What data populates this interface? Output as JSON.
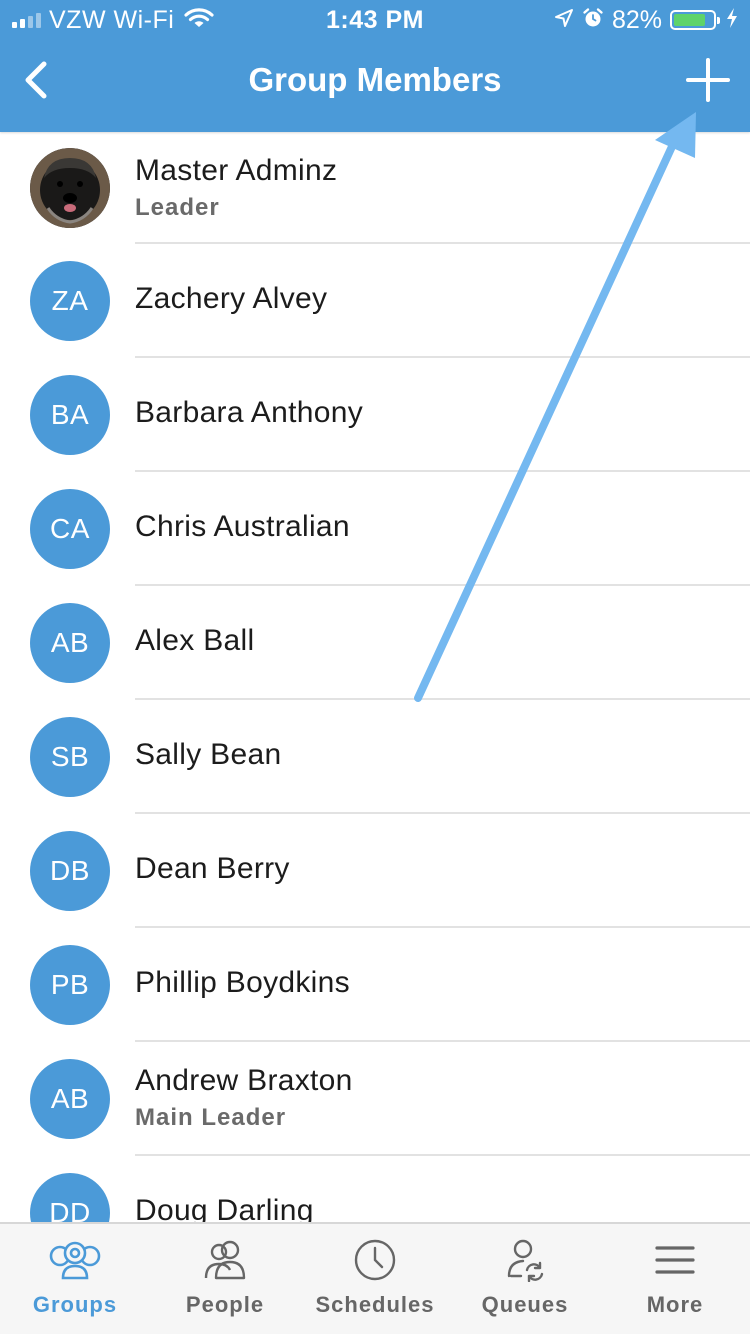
{
  "status_bar": {
    "carrier": "VZW Wi-Fi",
    "time": "1:43 PM",
    "battery_percent": "82%",
    "battery_level": 0.82
  },
  "nav": {
    "title": "Group Members",
    "back_icon": "chevron-left-icon",
    "add_icon": "plus-icon"
  },
  "members": [
    {
      "initials": "",
      "name": "Master Adminz",
      "role": "Leader",
      "photo": true
    },
    {
      "initials": "ZA",
      "name": "Zachery Alvey",
      "role": ""
    },
    {
      "initials": "BA",
      "name": "Barbara Anthony",
      "role": ""
    },
    {
      "initials": "CA",
      "name": "Chris Australian",
      "role": ""
    },
    {
      "initials": "AB",
      "name": "Alex Ball",
      "role": ""
    },
    {
      "initials": "SB",
      "name": "Sally Bean",
      "role": ""
    },
    {
      "initials": "DB",
      "name": "Dean Berry",
      "role": ""
    },
    {
      "initials": "PB",
      "name": "Phillip Boydkins",
      "role": ""
    },
    {
      "initials": "AB",
      "name": "Andrew Braxton",
      "role": "Main Leader"
    },
    {
      "initials": "DD",
      "name": "Doug Darling",
      "role": ""
    }
  ],
  "tabs": [
    {
      "label": "Groups",
      "icon": "groups-icon",
      "active": true
    },
    {
      "label": "People",
      "icon": "people-icon",
      "active": false
    },
    {
      "label": "Schedules",
      "icon": "clock-icon",
      "active": false
    },
    {
      "label": "Queues",
      "icon": "queues-icon",
      "active": false
    },
    {
      "label": "More",
      "icon": "menu-icon",
      "active": false
    }
  ],
  "colors": {
    "primary": "#4b9ad8",
    "annotation_arrow": "#74b8f0",
    "tab_inactive": "#666666"
  }
}
